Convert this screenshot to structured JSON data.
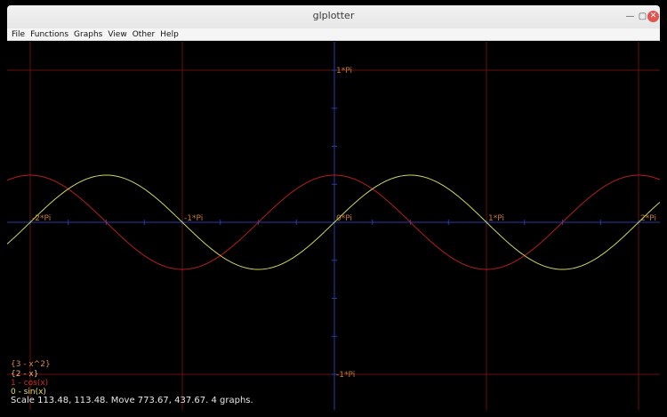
{
  "window": {
    "title": "glplotter"
  },
  "menu": [
    "File",
    "Functions",
    "Graphs",
    "View",
    "Other",
    "Help"
  ],
  "plot": {
    "x_ticks": [
      "-2*Pi",
      "-1*Pi",
      "0*Pi",
      "1*Pi",
      "2*Pi"
    ],
    "y_ticks": [
      "1*Pi",
      "-1*Pi"
    ],
    "colors": {
      "axis": "#2c3aa8",
      "grid": "#6a1010",
      "tick_label": "#c87a30",
      "cos": "#b41e1e",
      "sin": "#cfd45a"
    }
  },
  "legend": [
    {
      "label": "{3 - x^2}",
      "color": "#d4884a"
    },
    {
      "label": "{2 - x}",
      "color": "#e6b87a"
    },
    {
      "label": "1 - cos(x)",
      "color": "#d42a2a"
    },
    {
      "label": "0 - sin(x)",
      "color": "#e2e05a"
    }
  ],
  "status": "Scale 113.48, 113.48. Move 773.67, 437.67. 4 graphs.",
  "chart_data": {
    "type": "line",
    "x_ticks": [
      "-2*Pi",
      "-1*Pi",
      "0*Pi",
      "1*Pi",
      "2*Pi"
    ],
    "y_ticks": [
      "1*Pi",
      "-1*Pi"
    ],
    "series": [
      {
        "name": "1 - cos(x)",
        "function": "cos(x)"
      },
      {
        "name": "0 - sin(x)",
        "function": "sin(x)"
      }
    ]
  }
}
